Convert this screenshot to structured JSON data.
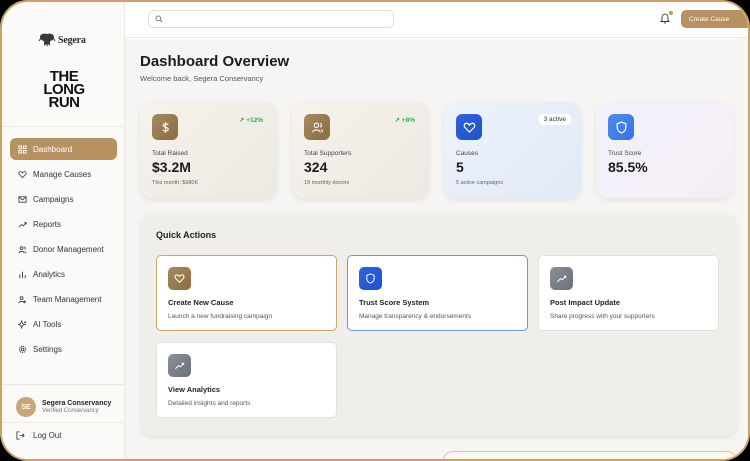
{
  "sidebar": {
    "brand_small": "Segera",
    "brand_large": [
      "THE",
      "LONG",
      "RUN"
    ],
    "items": [
      {
        "label": "Dashboard",
        "icon": "grid-icon",
        "active": true
      },
      {
        "label": "Manage Causes",
        "icon": "heart-icon"
      },
      {
        "label": "Campaigns",
        "icon": "mail-icon"
      },
      {
        "label": "Reports",
        "icon": "trend-icon"
      },
      {
        "label": "Donor Management",
        "icon": "users-icon"
      },
      {
        "label": "Analytics",
        "icon": "bar-chart-icon"
      },
      {
        "label": "Team Management",
        "icon": "team-icon"
      },
      {
        "label": "AI Tools",
        "icon": "sparkle-icon"
      },
      {
        "label": "Settings",
        "icon": "gear-icon"
      }
    ],
    "user": {
      "initials": "SE",
      "name": "Segera Conservancy",
      "status": "Verified Conservancy"
    },
    "logout_label": "Log Out"
  },
  "topbar": {
    "search_placeholder": "",
    "create_cause_label": "Create Cause"
  },
  "main": {
    "title": "Dashboard Overview",
    "subtitle": "Welcome back, Segera Conservancy",
    "stats": [
      {
        "label": "Total Raised",
        "value": "$3.2M",
        "note": "This month: $680K",
        "badge": "+12%",
        "icon": "dollar-icon"
      },
      {
        "label": "Total Supporters",
        "value": "324",
        "note": "18 monthly donors",
        "badge": "+8%",
        "icon": "users-icon"
      },
      {
        "label": "Causes",
        "value": "5",
        "note": "5 active campaigns",
        "badge": "3 active",
        "icon": "heart-icon"
      },
      {
        "label": "Trust Score",
        "value": "85.5%",
        "note": "",
        "badge": "",
        "icon": "shield-icon"
      }
    ],
    "quick_actions": {
      "title": "Quick Actions",
      "cards": [
        {
          "title": "Create New Cause",
          "desc": "Launch a new fundraising campaign",
          "icon": "heart-icon"
        },
        {
          "title": "Trust Score System",
          "desc": "Manage transparency & endorsements",
          "icon": "shield-icon"
        },
        {
          "title": "Post Impact Update",
          "desc": "Share progress with your supporters",
          "icon": "trend-icon"
        },
        {
          "title": "View Analytics",
          "desc": "Detailed insights and reports",
          "icon": "trend-icon"
        }
      ]
    }
  },
  "colors": {
    "accent": "#b89160",
    "frame_border": "#c8a46a",
    "growth_green": "#2fae52",
    "trust_blue": "#3a6fe0"
  }
}
